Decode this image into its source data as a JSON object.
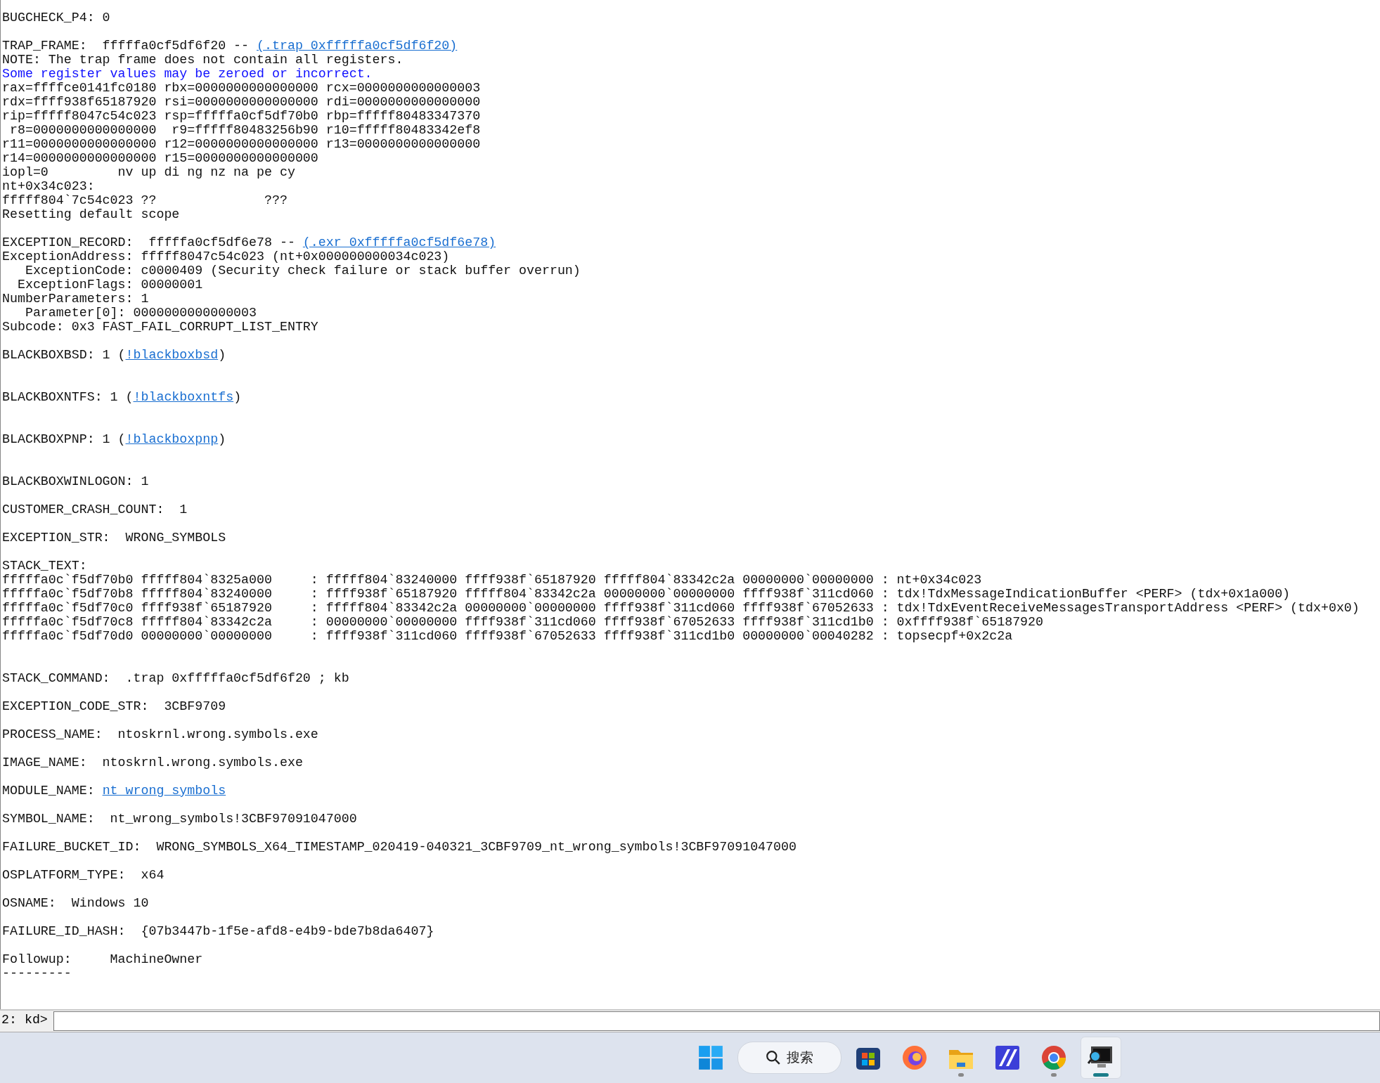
{
  "output": {
    "lines": [
      {
        "kind": "text",
        "segments": [
          {
            "kind": "plain",
            "text": "BUGCHECK_P4: 0"
          }
        ]
      },
      {
        "kind": "blank"
      },
      {
        "kind": "text",
        "segments": [
          {
            "kind": "plain",
            "text": "TRAP_FRAME:  fffffa0cf5df6f20 -- "
          },
          {
            "kind": "link",
            "text": "(.trap 0xfffffa0cf5df6f20)"
          }
        ]
      },
      {
        "kind": "text",
        "segments": [
          {
            "kind": "plain",
            "text": "NOTE: The trap frame does not contain all registers."
          }
        ]
      },
      {
        "kind": "text",
        "segments": [
          {
            "kind": "note",
            "text": "Some register values may be zeroed or incorrect."
          }
        ]
      },
      {
        "kind": "text",
        "segments": [
          {
            "kind": "plain",
            "text": "rax=ffffce0141fc0180 rbx=0000000000000000 rcx=0000000000000003"
          }
        ]
      },
      {
        "kind": "text",
        "segments": [
          {
            "kind": "plain",
            "text": "rdx=ffff938f65187920 rsi=0000000000000000 rdi=0000000000000000"
          }
        ]
      },
      {
        "kind": "text",
        "segments": [
          {
            "kind": "plain",
            "text": "rip=fffff8047c54c023 rsp=fffffa0cf5df70b0 rbp=fffff80483347370"
          }
        ]
      },
      {
        "kind": "text",
        "segments": [
          {
            "kind": "plain",
            "text": " r8=0000000000000000  r9=fffff80483256b90 r10=fffff80483342ef8"
          }
        ]
      },
      {
        "kind": "text",
        "segments": [
          {
            "kind": "plain",
            "text": "r11=0000000000000000 r12=0000000000000000 r13=0000000000000000"
          }
        ]
      },
      {
        "kind": "text",
        "segments": [
          {
            "kind": "plain",
            "text": "r14=0000000000000000 r15=0000000000000000"
          }
        ]
      },
      {
        "kind": "text",
        "segments": [
          {
            "kind": "plain",
            "text": "iopl=0         nv up di ng nz na pe cy"
          }
        ]
      },
      {
        "kind": "text",
        "segments": [
          {
            "kind": "plain",
            "text": "nt+0x34c023:"
          }
        ]
      },
      {
        "kind": "text",
        "segments": [
          {
            "kind": "plain",
            "text": "fffff804`7c54c023 ??              ???"
          }
        ]
      },
      {
        "kind": "text",
        "segments": [
          {
            "kind": "plain",
            "text": "Resetting default scope"
          }
        ]
      },
      {
        "kind": "blank"
      },
      {
        "kind": "text",
        "segments": [
          {
            "kind": "plain",
            "text": "EXCEPTION_RECORD:  fffffa0cf5df6e78 -- "
          },
          {
            "kind": "link",
            "text": "(.exr 0xfffffa0cf5df6e78)"
          }
        ]
      },
      {
        "kind": "text",
        "segments": [
          {
            "kind": "plain",
            "text": "ExceptionAddress: fffff8047c54c023 (nt+0x000000000034c023)"
          }
        ]
      },
      {
        "kind": "text",
        "segments": [
          {
            "kind": "plain",
            "text": "   ExceptionCode: c0000409 (Security check failure or stack buffer overrun)"
          }
        ]
      },
      {
        "kind": "text",
        "segments": [
          {
            "kind": "plain",
            "text": "  ExceptionFlags: 00000001"
          }
        ]
      },
      {
        "kind": "text",
        "segments": [
          {
            "kind": "plain",
            "text": "NumberParameters: 1"
          }
        ]
      },
      {
        "kind": "text",
        "segments": [
          {
            "kind": "plain",
            "text": "   Parameter[0]: 0000000000000003"
          }
        ]
      },
      {
        "kind": "text",
        "segments": [
          {
            "kind": "plain",
            "text": "Subcode: 0x3 FAST_FAIL_CORRUPT_LIST_ENTRY"
          }
        ]
      },
      {
        "kind": "blank"
      },
      {
        "kind": "text",
        "segments": [
          {
            "kind": "plain",
            "text": "BLACKBOXBSD: 1 ("
          },
          {
            "kind": "link",
            "text": "!blackboxbsd"
          },
          {
            "kind": "plain",
            "text": ")"
          }
        ]
      },
      {
        "kind": "blank"
      },
      {
        "kind": "blank"
      },
      {
        "kind": "text",
        "segments": [
          {
            "kind": "plain",
            "text": "BLACKBOXNTFS: 1 ("
          },
          {
            "kind": "link",
            "text": "!blackboxntfs"
          },
          {
            "kind": "plain",
            "text": ")"
          }
        ]
      },
      {
        "kind": "blank"
      },
      {
        "kind": "blank"
      },
      {
        "kind": "text",
        "segments": [
          {
            "kind": "plain",
            "text": "BLACKBOXPNP: 1 ("
          },
          {
            "kind": "link",
            "text": "!blackboxpnp"
          },
          {
            "kind": "plain",
            "text": ")"
          }
        ]
      },
      {
        "kind": "blank"
      },
      {
        "kind": "blank"
      },
      {
        "kind": "text",
        "segments": [
          {
            "kind": "plain",
            "text": "BLACKBOXWINLOGON: 1"
          }
        ]
      },
      {
        "kind": "blank"
      },
      {
        "kind": "text",
        "segments": [
          {
            "kind": "plain",
            "text": "CUSTOMER_CRASH_COUNT:  1"
          }
        ]
      },
      {
        "kind": "blank"
      },
      {
        "kind": "text",
        "segments": [
          {
            "kind": "plain",
            "text": "EXCEPTION_STR:  WRONG_SYMBOLS"
          }
        ]
      },
      {
        "kind": "blank"
      },
      {
        "kind": "text",
        "segments": [
          {
            "kind": "plain",
            "text": "STACK_TEXT:"
          }
        ]
      },
      {
        "kind": "text",
        "segments": [
          {
            "kind": "plain",
            "text": "fffffa0c`f5df70b0 fffff804`8325a000     : fffff804`83240000 ffff938f`65187920 fffff804`83342c2a 00000000`00000000 : nt+0x34c023"
          }
        ]
      },
      {
        "kind": "text",
        "segments": [
          {
            "kind": "plain",
            "text": "fffffa0c`f5df70b8 fffff804`83240000     : ffff938f`65187920 fffff804`83342c2a 00000000`00000000 ffff938f`311cd060 : tdx!TdxMessageIndicationBuffer <PERF> (tdx+0x1a000)"
          }
        ]
      },
      {
        "kind": "text",
        "segments": [
          {
            "kind": "plain",
            "text": "fffffa0c`f5df70c0 ffff938f`65187920     : fffff804`83342c2a 00000000`00000000 ffff938f`311cd060 ffff938f`67052633 : tdx!TdxEventReceiveMessagesTransportAddress <PERF> (tdx+0x0)"
          }
        ]
      },
      {
        "kind": "text",
        "segments": [
          {
            "kind": "plain",
            "text": "fffffa0c`f5df70c8 fffff804`83342c2a     : 00000000`00000000 ffff938f`311cd060 ffff938f`67052633 ffff938f`311cd1b0 : 0xffff938f`65187920"
          }
        ]
      },
      {
        "kind": "text",
        "segments": [
          {
            "kind": "plain",
            "text": "fffffa0c`f5df70d0 00000000`00000000     : ffff938f`311cd060 ffff938f`67052633 ffff938f`311cd1b0 00000000`00040282 : topsecpf+0x2c2a"
          }
        ]
      },
      {
        "kind": "blank"
      },
      {
        "kind": "blank"
      },
      {
        "kind": "text",
        "segments": [
          {
            "kind": "plain",
            "text": "STACK_COMMAND:  .trap 0xfffffa0cf5df6f20 ; kb"
          }
        ]
      },
      {
        "kind": "blank"
      },
      {
        "kind": "text",
        "segments": [
          {
            "kind": "plain",
            "text": "EXCEPTION_CODE_STR:  3CBF9709"
          }
        ]
      },
      {
        "kind": "blank"
      },
      {
        "kind": "text",
        "segments": [
          {
            "kind": "plain",
            "text": "PROCESS_NAME:  ntoskrnl.wrong.symbols.exe"
          }
        ]
      },
      {
        "kind": "blank"
      },
      {
        "kind": "text",
        "segments": [
          {
            "kind": "plain",
            "text": "IMAGE_NAME:  ntoskrnl.wrong.symbols.exe"
          }
        ]
      },
      {
        "kind": "blank"
      },
      {
        "kind": "text",
        "segments": [
          {
            "kind": "plain",
            "text": "MODULE_NAME: "
          },
          {
            "kind": "link",
            "text": "nt_wrong_symbols"
          }
        ]
      },
      {
        "kind": "blank"
      },
      {
        "kind": "text",
        "segments": [
          {
            "kind": "plain",
            "text": "SYMBOL_NAME:  nt_wrong_symbols!3CBF97091047000"
          }
        ]
      },
      {
        "kind": "blank"
      },
      {
        "kind": "text",
        "segments": [
          {
            "kind": "plain",
            "text": "FAILURE_BUCKET_ID:  WRONG_SYMBOLS_X64_TIMESTAMP_020419-040321_3CBF9709_nt_wrong_symbols!3CBF97091047000"
          }
        ]
      },
      {
        "kind": "blank"
      },
      {
        "kind": "text",
        "segments": [
          {
            "kind": "plain",
            "text": "OSPLATFORM_TYPE:  x64"
          }
        ]
      },
      {
        "kind": "blank"
      },
      {
        "kind": "text",
        "segments": [
          {
            "kind": "plain",
            "text": "OSNAME:  Windows 10"
          }
        ]
      },
      {
        "kind": "blank"
      },
      {
        "kind": "text",
        "segments": [
          {
            "kind": "plain",
            "text": "FAILURE_ID_HASH:  {07b3447b-1f5e-afd8-e4b9-bde7b8da6407}"
          }
        ]
      },
      {
        "kind": "blank"
      },
      {
        "kind": "text",
        "segments": [
          {
            "kind": "plain",
            "text": "Followup:     MachineOwner"
          }
        ]
      },
      {
        "kind": "text",
        "segments": [
          {
            "kind": "plain",
            "text": "---------"
          }
        ]
      }
    ]
  },
  "command": {
    "prompt": "2: kd>"
  },
  "taskbar": {
    "search_label": "搜索",
    "apps": [
      {
        "kind": "store",
        "running": false,
        "active": false
      },
      {
        "kind": "firefox",
        "running": false,
        "active": false
      },
      {
        "kind": "folder",
        "running": true,
        "active": false
      },
      {
        "kind": "ide",
        "running": false,
        "active": false
      },
      {
        "kind": "chrome",
        "running": true,
        "active": false
      },
      {
        "kind": "debugger",
        "running": true,
        "active": true
      }
    ]
  }
}
